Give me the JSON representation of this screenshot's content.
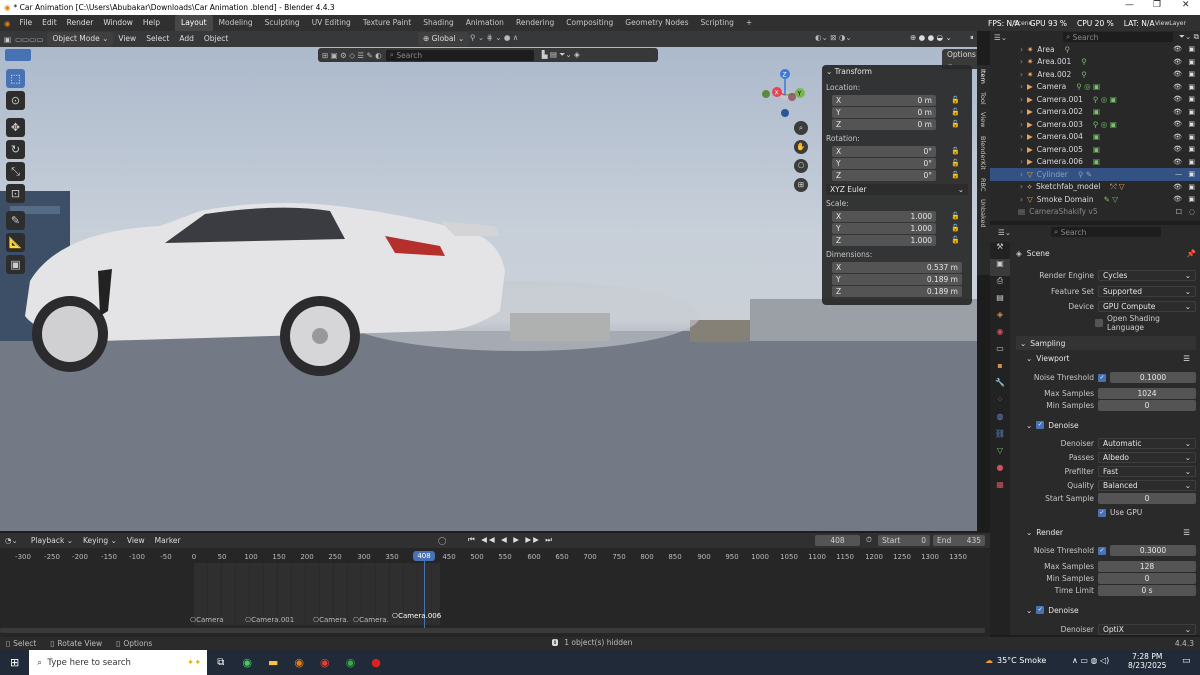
{
  "window": {
    "title": "* Car Animation  [C:\\Users\\Abubakar\\Downloads\\Car Animation .blend] - Blender 4.4.3"
  },
  "menu": [
    "File",
    "Edit",
    "Render",
    "Window",
    "Help"
  ],
  "workspaces": [
    "Layout",
    "Modeling",
    "Sculpting",
    "UV Editing",
    "Texture Paint",
    "Shading",
    "Animation",
    "Rendering",
    "Compositing",
    "Geometry Nodes",
    "Scripting"
  ],
  "active_workspace": "Layout",
  "topstats": {
    "fps": "FPS: N/A",
    "gpu": "GPU 93 %",
    "cpu": "CPU 20 %",
    "lat": "LAT: N/A",
    "scene": "Scene",
    "viewlayer": "ViewLayer"
  },
  "viewport": {
    "mode": "Object Mode",
    "view": "View",
    "select": "Select",
    "add": "Add",
    "object": "Object",
    "orientation": "Global",
    "search_placeholder": "Search",
    "options": "Options"
  },
  "gizmo": {
    "x": "X",
    "y": "Y",
    "z": "Z"
  },
  "transform": {
    "title": "Transform",
    "location_label": "Location:",
    "location": [
      {
        "axis": "X",
        "val": "0 m"
      },
      {
        "axis": "Y",
        "val": "0 m"
      },
      {
        "axis": "Z",
        "val": "0 m"
      }
    ],
    "rotation_label": "Rotation:",
    "rotation": [
      {
        "axis": "X",
        "val": "0°"
      },
      {
        "axis": "Y",
        "val": "0°"
      },
      {
        "axis": "Z",
        "val": "0°"
      }
    ],
    "rotation_mode": "XYZ Euler",
    "scale_label": "Scale:",
    "scale": [
      {
        "axis": "X",
        "val": "1.000"
      },
      {
        "axis": "Y",
        "val": "1.000"
      },
      {
        "axis": "Z",
        "val": "1.000"
      }
    ],
    "dimensions_label": "Dimensions:",
    "dimensions": [
      {
        "axis": "X",
        "val": "0.537 m"
      },
      {
        "axis": "Y",
        "val": "0.189 m"
      },
      {
        "axis": "Z",
        "val": "0.189 m"
      }
    ]
  },
  "npanel_tabs": [
    "Item",
    "Tool",
    "View",
    "BlenderKit",
    "RBC",
    "Unbaked"
  ],
  "outliner": {
    "search_placeholder": "Search",
    "items": [
      "Area",
      "Area.001",
      "Area.002",
      "Camera",
      "Camera.001",
      "Camera.002",
      "Camera.003",
      "Camera.004",
      "Camera.005",
      "Camera.006",
      "Cylinder",
      "Sketchfab_model",
      "Smoke Domain",
      "CameraShakify v5"
    ],
    "selected": "Cylinder"
  },
  "properties": {
    "search_placeholder": "Search",
    "scene": "Scene",
    "render_engine_label": "Render Engine",
    "render_engine": "Cycles",
    "feature_set_label": "Feature Set",
    "feature_set": "Supported",
    "device_label": "Device",
    "device": "GPU Compute",
    "osl_label": "Open Shading Language",
    "sampling": "Sampling",
    "viewport_section": "Viewport",
    "noise_threshold_label": "Noise Threshold",
    "vp_noise": "0.1000",
    "max_samples_label": "Max Samples",
    "vp_max": "1024",
    "min_samples_label": "Min Samples",
    "vp_min": "0",
    "denoise_label": "Denoise",
    "denoiser_label": "Denoiser",
    "vp_denoiser": "Automatic",
    "passes_label": "Passes",
    "vp_passes": "Albedo",
    "prefilter_label": "Prefilter",
    "vp_prefilter": "Fast",
    "quality_label": "Quality",
    "vp_quality": "Balanced",
    "start_sample_label": "Start Sample",
    "vp_start": "0",
    "use_gpu_label": "Use GPU",
    "render_section": "Render",
    "r_noise": "0.3000",
    "r_max": "128",
    "r_min": "0",
    "time_limit_label": "Time Limit",
    "r_time": "0 s",
    "r_denoiser": "OptiX"
  },
  "timeline": {
    "playback": "Playback",
    "keying": "Keying",
    "view": "View",
    "marker": "Marker",
    "current_frame": "408",
    "start_label": "Start",
    "start": "0",
    "end_label": "End",
    "end": "435",
    "ticks": [
      "-300",
      "-250",
      "-200",
      "-150",
      "-100",
      "-50",
      "0",
      "50",
      "100",
      "150",
      "200",
      "250",
      "300",
      "350",
      "408",
      "450",
      "500",
      "550",
      "600",
      "650",
      "700",
      "750",
      "800",
      "850",
      "900",
      "950",
      "1000",
      "1050",
      "1100",
      "1150",
      "1200",
      "1250",
      "1300",
      "1350"
    ],
    "markers": [
      "Camera",
      "Camera.001",
      "Camera.",
      "Camera.",
      "Camera.006"
    ]
  },
  "status": {
    "select": "Select",
    "rotate": "Rotate View",
    "options": "Options",
    "info": "1 object(s) hidden",
    "version": "4.4.3"
  },
  "taskbar": {
    "search": "Type here to search",
    "weather": "35°C  Smoke",
    "time": "7:28 PM",
    "date": "8/23/2025"
  }
}
